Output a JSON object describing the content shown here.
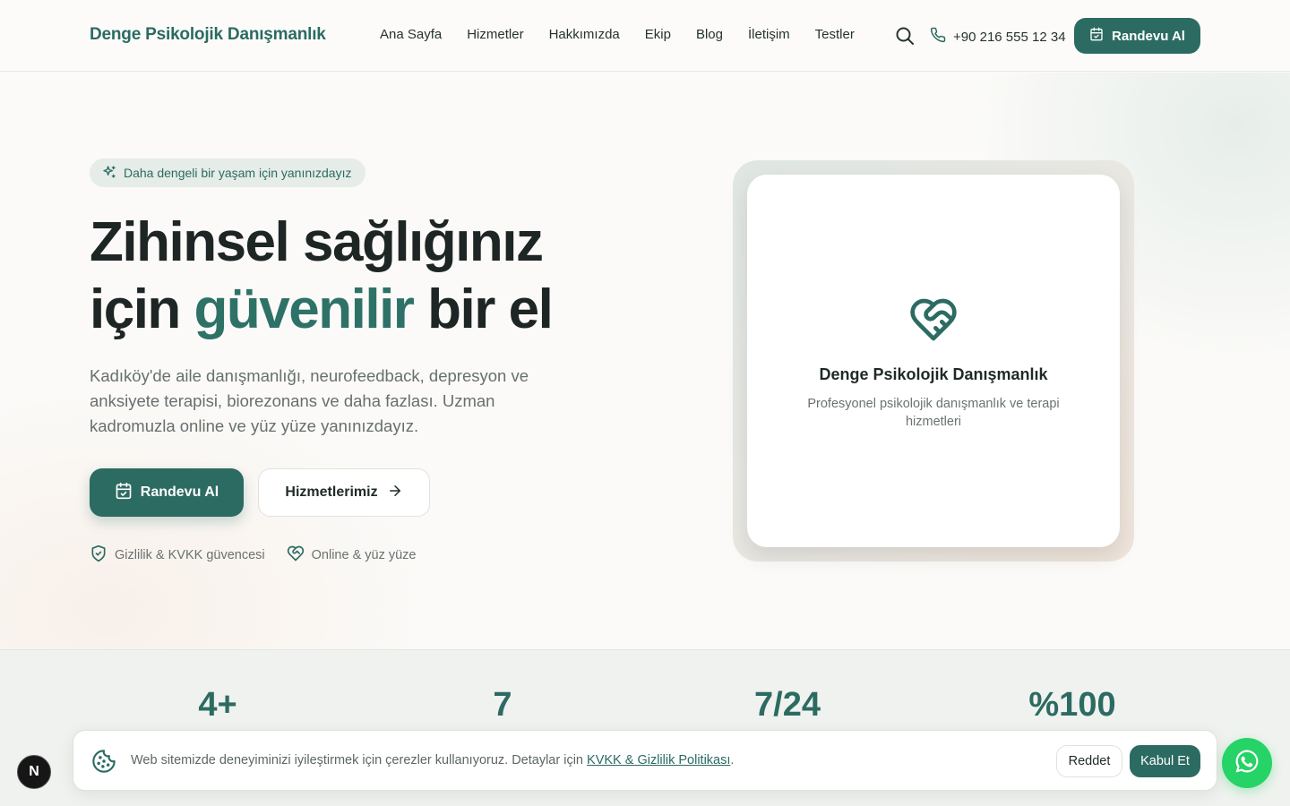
{
  "header": {
    "logo": "Denge Psikolojik Danışmanlık",
    "nav": [
      "Ana Sayfa",
      "Hizmetler",
      "Hakkımızda",
      "Ekip",
      "Blog",
      "İletişim",
      "Testler"
    ],
    "phone": "+90 216 555 12 34",
    "cta_label": "Randevu Al",
    "icons": {
      "search": "search-icon",
      "phone": "phone-icon",
      "calendar": "calendar-check-icon"
    }
  },
  "hero": {
    "pill": "Daha dengeli bir yaşam için yanınızdayız",
    "title_line1": "Zihinsel sağlığınız",
    "title_pre": "için",
    "title_accent": "güvenilir",
    "title_post": "bir el",
    "description": "Kadıköy'de aile danışmanlığı, neurofeedback, depresyon ve anksiyete terapisi, biorezonans ve daha fazlası. Uzman kadromuzla online ve yüz yüze yanınızdayız.",
    "primary_cta": "Randevu Al",
    "secondary_cta": "Hizmetlerimiz",
    "trust": [
      "Gizlilik & KVKK güvencesi",
      "Online & yüz yüze"
    ]
  },
  "card": {
    "title": "Denge Psikolojik Danışmanlık",
    "subtitle": "Profesyonel psikolojik danışmanlık ve terapi hizmetleri"
  },
  "stats": [
    "4+",
    "7",
    "7/24",
    "%100"
  ],
  "cookie": {
    "text": "Web sitemizde deneyiminizi iyileştirmek için çerezler kullanıyoruz. Detaylar için",
    "link": "KVKK & Gizlilik Politikası",
    "end": ".",
    "reject": "Reddet",
    "accept": "Kabul Et"
  },
  "badge": "N",
  "colors": {
    "brand": "#2c6b62",
    "whatsapp": "#25d366"
  }
}
